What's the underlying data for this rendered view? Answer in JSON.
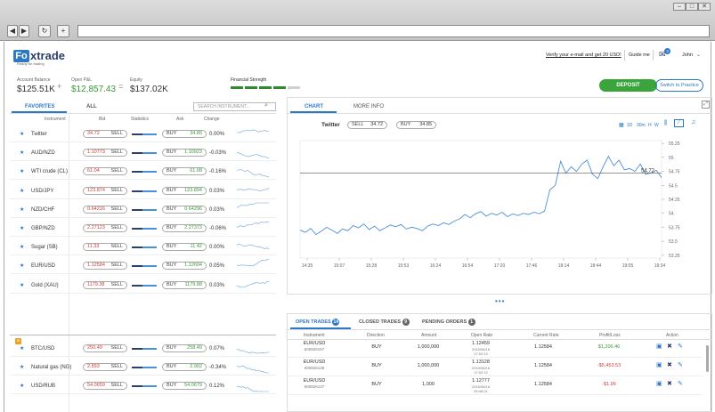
{
  "browser": {
    "back": "◀",
    "forward": "▶",
    "reload": "↻",
    "newtab": "+"
  },
  "header": {
    "logo_mark": "Fo",
    "logo_text": "xtrade",
    "logo_tagline": "Ready for trading",
    "verify_link": "Verify your e-mail and get 20 USD!",
    "guide": "Guide me",
    "notif_count": "3",
    "user": "John"
  },
  "summary": {
    "balance_label": "Account Balance",
    "balance_value": "$125.51K",
    "plus": "+",
    "pl_label": "Open P&L",
    "pl_value": "$12,857.43",
    "equals": "=",
    "equity_label": "Equity",
    "equity_value": "$137.02K",
    "strength_label": "Financial Strength",
    "strength_level": 0.7
  },
  "actions": {
    "deposit": "DEPOSIT",
    "practice": "Switch to Practice"
  },
  "instruments": {
    "tabs": [
      "FAVORITES",
      "ALL"
    ],
    "search_placeholder": "SEARCH INSTRUMENT...",
    "headers": {
      "instrument": "Instrument",
      "bid": "Bid",
      "statistics": "Statistics",
      "ask": "Ask",
      "change": "Change"
    },
    "sell": "SELL",
    "buy": "BUY",
    "rows": [
      {
        "name": "Twitter",
        "bid": "34.72",
        "ask": "34.85",
        "change": "0.00%",
        "dir": "n"
      },
      {
        "name": "AUD/NZD",
        "bid": "1.10773",
        "ask": "1.10923",
        "change": "-0.03%",
        "dir": "d"
      },
      {
        "name": "WTI crude (CL)",
        "bid": "61.04",
        "ask": "61.08",
        "change": "-0.16%",
        "dir": "d"
      },
      {
        "name": "USD/JPY",
        "bid": "123.874",
        "ask": "123.894",
        "change": "0.03%",
        "dir": "u"
      },
      {
        "name": "NZD/CHF",
        "bid": "0.64216",
        "ask": "0.64296",
        "change": "0.03%",
        "dir": "u"
      },
      {
        "name": "GBP/NZD",
        "bid": "2.27123",
        "ask": "2.27373",
        "change": "-0.06%",
        "dir": "u"
      },
      {
        "name": "Sugar (SB)",
        "bid": "11.33",
        "ask": "11.42",
        "change": "0.00%",
        "dir": "n"
      },
      {
        "name": "EUR/USD",
        "bid": "1.12584",
        "ask": "1.12604",
        "change": "0.05%",
        "dir": "u"
      },
      {
        "name": "Gold (XAU)",
        "bid": "1179.38",
        "ask": "1179.88",
        "change": "0.03%",
        "dir": "u"
      }
    ],
    "lower_rows": [
      {
        "name": "BTC/USD",
        "bid": "250.49",
        "ask": "258.49",
        "change": "0.07%",
        "dir": "d"
      },
      {
        "name": "Natural gas (NG)",
        "bid": "2.893",
        "ask": "2.902",
        "change": "-0.34%",
        "dir": "d"
      },
      {
        "name": "USD/RUB",
        "bid": "54.0659",
        "ask": "54.0679",
        "change": "0.12%",
        "dir": "d"
      }
    ]
  },
  "chart": {
    "tabs": [
      "CHART",
      "MORE INFO"
    ],
    "instrument": "Twitter",
    "sell_label": "SELL",
    "sell_value": "34.72",
    "buy_label": "BUY",
    "buy_value": "34.85",
    "timeframes": [
      "1D",
      "30m",
      "H",
      "W"
    ],
    "chart_data": {
      "type": "line",
      "x_ticks": [
        "14:35",
        "15:07",
        "15:28",
        "15:53",
        "16:24",
        "16:54",
        "17:20",
        "17:46",
        "18:14",
        "18:44",
        "19:05",
        "19:34"
      ],
      "y_ticks": [
        "55.25",
        "55",
        "54.75",
        "54.5",
        "54.25",
        "54",
        "53.75",
        "53.5",
        "53.25"
      ],
      "ylim": [
        53.2,
        55.3
      ],
      "current_label": "54.72",
      "current_value": 54.72,
      "series": [
        {
          "values": [
            53.7,
            53.66,
            53.73,
            53.62,
            53.68,
            53.75,
            53.7,
            53.64,
            53.72,
            53.69,
            53.78,
            53.74,
            53.81,
            53.71,
            53.77,
            53.69,
            53.74,
            53.79,
            53.76,
            53.8,
            53.72,
            53.75,
            53.73,
            53.69,
            53.77,
            53.81,
            53.78,
            53.83,
            53.8,
            53.86,
            53.9,
            53.98,
            53.92,
            53.99,
            54.03,
            53.95,
            54.0,
            53.97,
            54.02,
            53.94,
            53.99,
            53.96,
            54.0,
            53.98,
            54.02,
            53.99,
            54.04,
            54.42,
            54.5,
            54.93,
            54.72,
            54.83,
            54.75,
            54.88,
            54.95,
            54.7,
            54.62,
            54.83,
            55.02,
            54.85,
            54.95,
            54.78,
            54.8,
            54.75,
            54.88,
            54.7,
            54.72,
            54.77,
            54.64
          ]
        }
      ]
    }
  },
  "trades": {
    "tabs": [
      {
        "label": "OPEN TRADES",
        "count": "14"
      },
      {
        "label": "CLOSED TRADES",
        "count": "9"
      },
      {
        "label": "PENDING ORDERS",
        "count": "1"
      }
    ],
    "headers": {
      "instrument": "Instrument",
      "direction": "Direction",
      "amount": "Amount",
      "open_rate": "Open Rate",
      "current_rate": "Current Rate",
      "pl": "Profit/Loss",
      "action": "Action"
    },
    "rows": [
      {
        "instrument": "EUR/USD",
        "id": "600826157",
        "direction": "BUY",
        "amount": "1,000,000",
        "open_rate": "1.12459",
        "open_date": "2015/06/16",
        "open_time": "17:02:14",
        "current": "1.12584",
        "pl": "$1,206.46",
        "pl_pos": true
      },
      {
        "instrument": "EUR/USD",
        "id": "600826138",
        "direction": "BUY",
        "amount": "1,000,000",
        "open_rate": "1.13128",
        "open_date": "2015/06/16",
        "open_time": "17:02:12",
        "current": "1.12584",
        "pl": "-$5,453.53",
        "pl_pos": false
      },
      {
        "instrument": "EUR/USD",
        "id": "600826137",
        "direction": "BUY",
        "amount": "1,000",
        "open_rate": "1.12777",
        "open_date": "2015/06/16",
        "open_time": "09:48:21",
        "current": "1.12584",
        "pl": "-$1.96",
        "pl_pos": false
      }
    ]
  },
  "colors": {
    "accent": "#2b78c5",
    "positive": "#3a9a3a",
    "negative": "#d23a3a"
  }
}
